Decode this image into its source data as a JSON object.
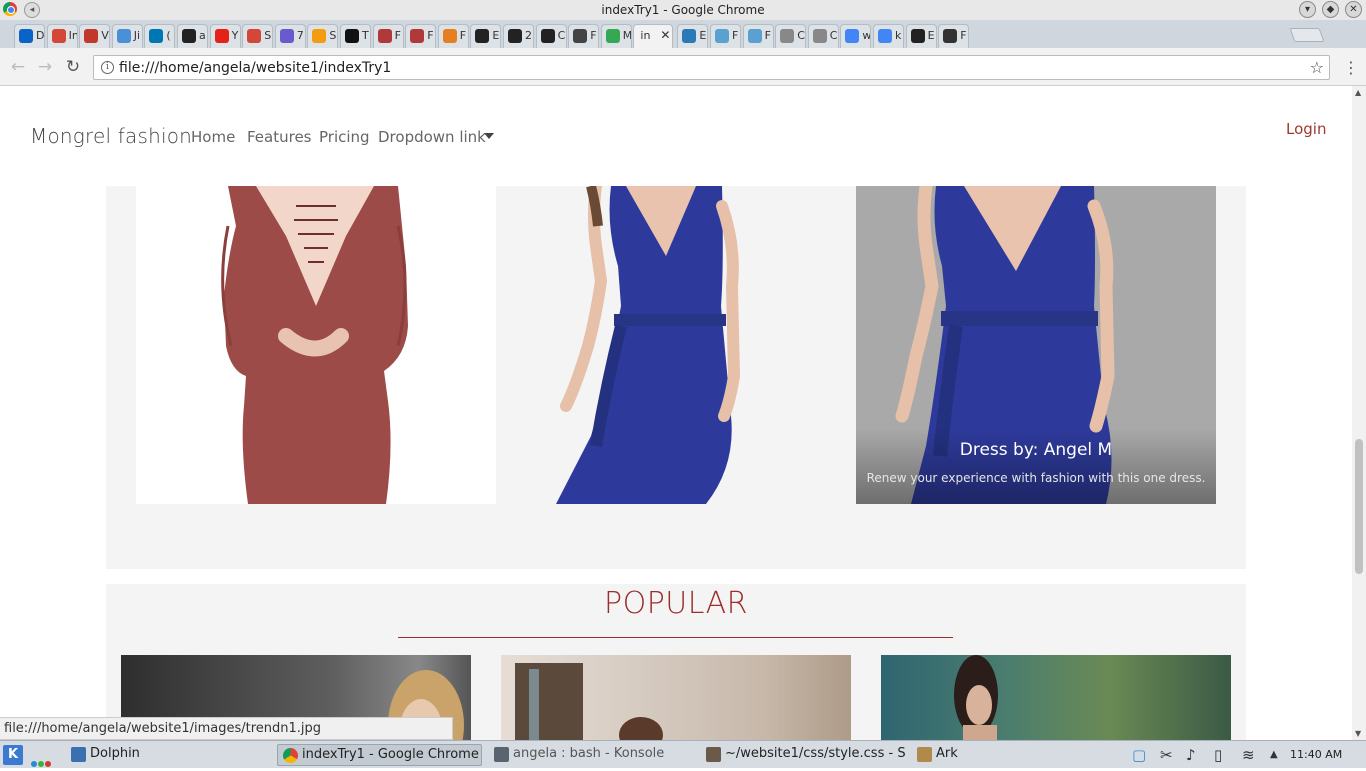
{
  "window": {
    "title": "indexTry1 - Google Chrome"
  },
  "tabs": [
    {
      "label": "D",
      "icon": "onedrive-icon",
      "color": "#0a64c8"
    },
    {
      "label": "In",
      "icon": "gmail-icon",
      "color": "#d44638"
    },
    {
      "label": "V",
      "icon": "v-icon",
      "color": "#c0392b"
    },
    {
      "label": "Ji",
      "icon": "info-icon",
      "color": "#4a90d9"
    },
    {
      "label": "(",
      "icon": "linkedin-icon",
      "color": "#0077b5"
    },
    {
      "label": "a",
      "icon": "blackboard-icon",
      "color": "#222"
    },
    {
      "label": "Y",
      "icon": "youtube-icon",
      "color": "#e62117"
    },
    {
      "label": "S",
      "icon": "m-icon",
      "color": "#d44638"
    },
    {
      "label": "7",
      "icon": "pocket-icon",
      "color": "#6a5acd"
    },
    {
      "label": "S",
      "icon": "asterisk-icon",
      "color": "#f39c12"
    },
    {
      "label": "T",
      "icon": "medium-icon",
      "color": "#111"
    },
    {
      "label": "F",
      "icon": "scrum-icon",
      "color": "#b03a3a"
    },
    {
      "label": "F",
      "icon": "scrum-icon",
      "color": "#b03a3a"
    },
    {
      "label": "F",
      "icon": "pinwheel-icon",
      "color": "#e67e22"
    },
    {
      "label": "E",
      "icon": "diamond-icon",
      "color": "#222"
    },
    {
      "label": "2",
      "icon": "f-icon",
      "color": "#222"
    },
    {
      "label": "C",
      "icon": "codepen-icon",
      "color": "#222"
    },
    {
      "label": "F",
      "icon": "gem-icon",
      "color": "#444"
    },
    {
      "label": "M",
      "icon": "maps-icon",
      "color": "#34a853"
    },
    {
      "label": "in",
      "icon": "",
      "color": "#555",
      "active": true
    },
    {
      "label": "E",
      "icon": "bracket-icon",
      "color": "#2a7ab8"
    },
    {
      "label": "F",
      "icon": "code-icon",
      "color": "#5aa0d0"
    },
    {
      "label": "F",
      "icon": "code-icon",
      "color": "#5aa0d0"
    },
    {
      "label": "C",
      "icon": "file-icon",
      "color": "#888"
    },
    {
      "label": "C",
      "icon": "file-icon",
      "color": "#888"
    },
    {
      "label": "w",
      "icon": "google-icon",
      "color": "#4285f4"
    },
    {
      "label": "k",
      "icon": "google-icon",
      "color": "#4285f4"
    },
    {
      "label": "E",
      "icon": "b-icon",
      "color": "#222"
    },
    {
      "label": "F",
      "icon": "x-box-icon",
      "color": "#333"
    }
  ],
  "toolbar": {
    "url": "file:///home/angela/website1/indexTry1"
  },
  "site": {
    "brand": "Mongrel fashion",
    "nav": [
      "Home",
      "Features",
      "Pricing",
      "Dropdown link"
    ],
    "login": "Login"
  },
  "gallery": {
    "caption_title": "Dress by: Angel M",
    "caption_text": "Renew your experience with fashion with this one dress."
  },
  "popular": {
    "title": "POPULAR"
  },
  "status_url": "file:///home/angela/website1/images/trendn1.jpg",
  "taskbar": {
    "items": [
      "Dolphin",
      "indexTry1 - Google Chrome",
      "angela : bash - Konsole",
      "~/website1/css/style.css - S",
      "Ark"
    ],
    "clock": "11:40 AM"
  },
  "colors": {
    "accent": "#9b2d2a",
    "login": "#a0392f"
  }
}
